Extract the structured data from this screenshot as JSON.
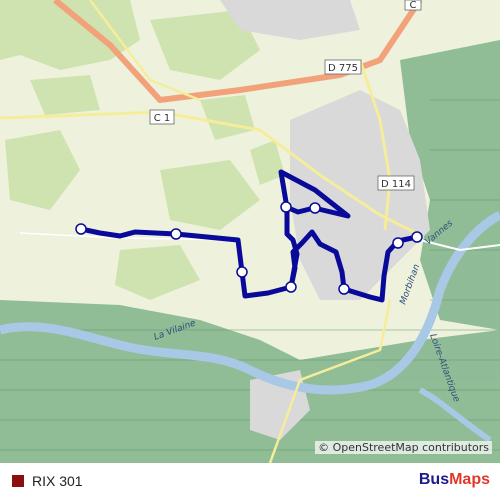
{
  "map": {
    "road_labels": [
      "D 775",
      "C 1",
      "D 114",
      "C"
    ],
    "river_labels": [
      "La Vilaine",
      "Vannes",
      "Morbihan",
      "Loire-Atlantique"
    ],
    "attribution": "© OpenStreetMap contributors",
    "route_color": "#0a0a9a",
    "colors": {
      "land": "#eef2dc",
      "forest": "#cfe3b0",
      "wetland": "#7fb38a",
      "water": "#a9c8e6",
      "urban": "#d9d9d9",
      "main_road": "#f2a27a"
    }
  },
  "legend": {
    "route_name": "RIX 301",
    "route_color": "#8b0f0f"
  },
  "brand": {
    "part1": "Bus",
    "part2": "Maps"
  }
}
